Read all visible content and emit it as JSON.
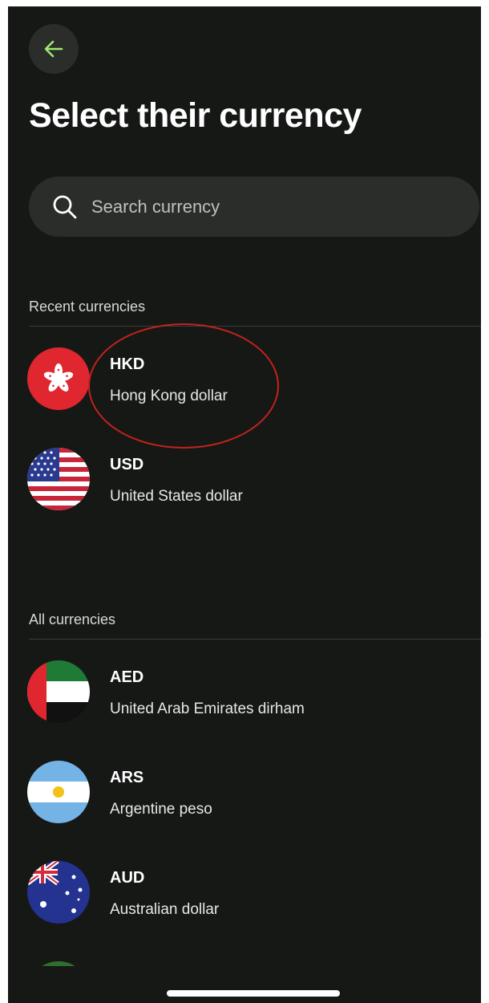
{
  "header": {
    "title": "Select their currency"
  },
  "search": {
    "placeholder": "Search currency",
    "value": ""
  },
  "recent": {
    "label": "Recent currencies",
    "items": [
      {
        "code": "HKD",
        "name": "Hong Kong dollar",
        "flag": "hong-kong-flag-icon"
      },
      {
        "code": "USD",
        "name": "United States dollar",
        "flag": "usa-flag-icon"
      }
    ]
  },
  "all": {
    "label": "All currencies",
    "items": [
      {
        "code": "AED",
        "name": "United Arab Emirates dirham",
        "flag": "uae-flag-icon"
      },
      {
        "code": "ARS",
        "name": "Argentine peso",
        "flag": "argentina-flag-icon"
      },
      {
        "code": "AUD",
        "name": "Australian dollar",
        "flag": "australia-flag-icon"
      }
    ]
  },
  "colors": {
    "background": "#161816",
    "surface": "#2b2d2b",
    "accent": "#9fe870",
    "highlight_circle": "#c4221c"
  }
}
